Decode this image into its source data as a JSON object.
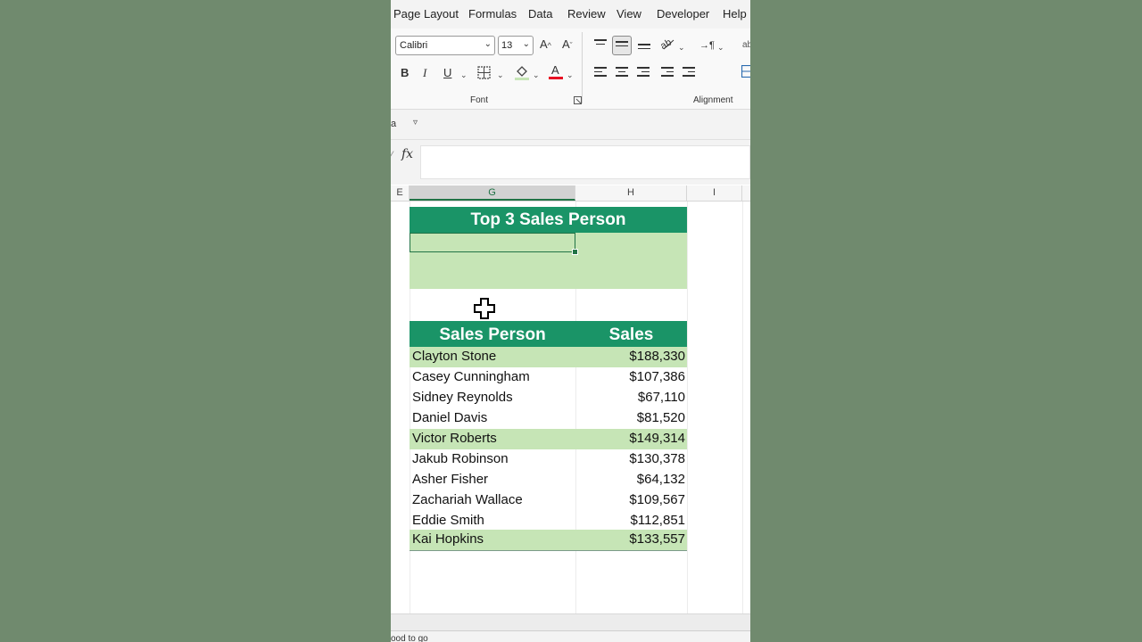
{
  "menu": {
    "tabs": [
      {
        "label": "Page Layout"
      },
      {
        "label": "Formulas"
      },
      {
        "label": "Data"
      },
      {
        "label": "Review"
      },
      {
        "label": "View"
      },
      {
        "label": "Developer"
      },
      {
        "label": "Help"
      }
    ]
  },
  "ribbon": {
    "font_name": "Calibri",
    "font_size": "13",
    "group_font": "Font",
    "group_alignment": "Alignment",
    "bold": "B",
    "italic": "I",
    "underline": "U",
    "grow_font": "A",
    "shrink_font": "A",
    "font_color": "A",
    "ltr": "¶"
  },
  "quickbar": {
    "name_box_fragment": "a"
  },
  "formula": {
    "fx": "fx",
    "value": ""
  },
  "columns": {
    "g": "G",
    "h": "H",
    "i": "I",
    "e": "E"
  },
  "sheet": {
    "title": "Top 3 Sales Person",
    "table": {
      "headers": {
        "name": "Sales Person",
        "sales": "Sales"
      },
      "rows": [
        {
          "name": "Clayton Stone",
          "sales": "$188,330"
        },
        {
          "name": "Casey Cunningham",
          "sales": "$107,386"
        },
        {
          "name": "Sidney Reynolds",
          "sales": "$67,110"
        },
        {
          "name": "Daniel Davis",
          "sales": "$81,520"
        },
        {
          "name": "Victor Roberts",
          "sales": "$149,314"
        },
        {
          "name": "Jakub Robinson",
          "sales": "$130,378"
        },
        {
          "name": "Asher Fisher",
          "sales": "$64,132"
        },
        {
          "name": "Zachariah Wallace",
          "sales": "$109,567"
        },
        {
          "name": "Eddie Smith",
          "sales": "$112,851"
        },
        {
          "name": "Kai Hopkins",
          "sales": "$133,557"
        }
      ]
    }
  },
  "status": {
    "text": "ood to go"
  },
  "colors": {
    "header_green": "#1a9467",
    "highlight_green": "#c6e5b6",
    "excel_green": "#217346",
    "font_color_red": "#e81123",
    "fill_color_green": "#c6e5b6",
    "background": "#708a6e"
  }
}
